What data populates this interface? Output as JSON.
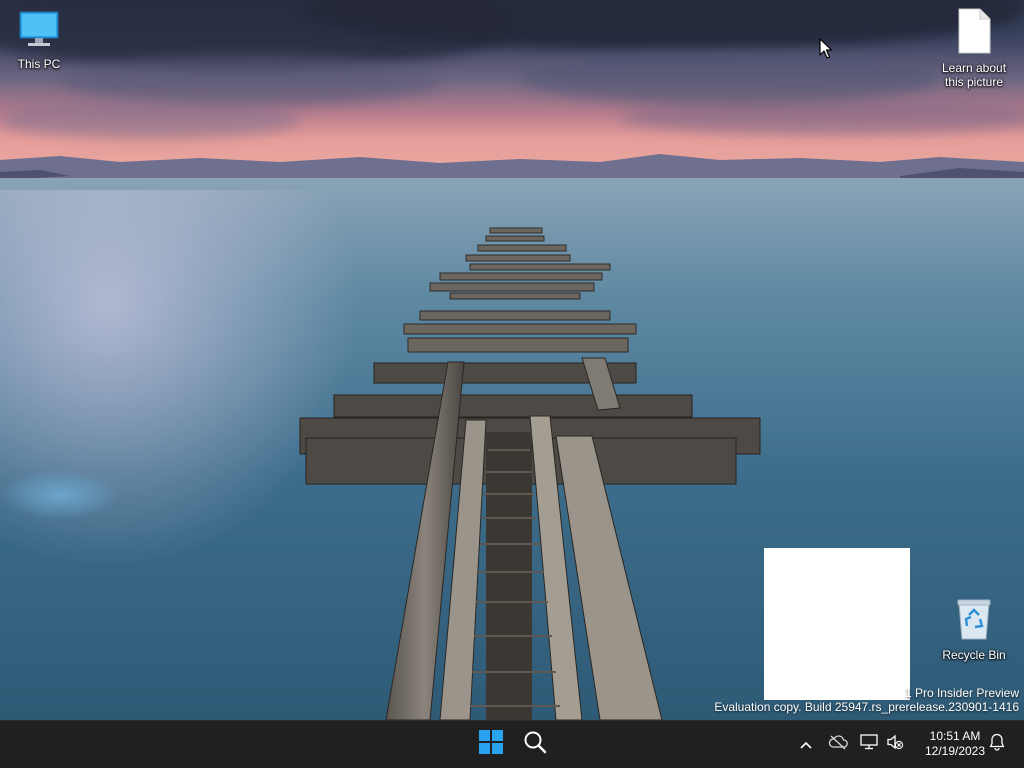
{
  "desktop": {
    "icons": [
      {
        "label": "This PC",
        "icon": "computer-icon"
      },
      {
        "label": "Learn about this picture",
        "icon": "blank-file-icon"
      },
      {
        "label": "Recycle Bin",
        "icon": "recycle-bin-icon"
      }
    ],
    "watermark": {
      "line1": "1 Pro Insider Preview",
      "line2": "Evaluation copy. Build 25947.rs_prerelease.230901-1416"
    }
  },
  "taskbar": {
    "start_icon": "windows-start-icon",
    "search_icon": "search-icon",
    "tray": {
      "chevron_icon": "chevron-up-icon",
      "onedrive_icon": "onedrive-offline-icon",
      "network_icon": "network-icon",
      "volume_icon": "volume-muted-icon",
      "notification_icon": "bell-icon"
    },
    "clock": {
      "time": "10:51 AM",
      "date": "12/19/2023"
    }
  },
  "colors": {
    "taskbar_bg": "#202020",
    "win_blue": "#29a3f0"
  }
}
